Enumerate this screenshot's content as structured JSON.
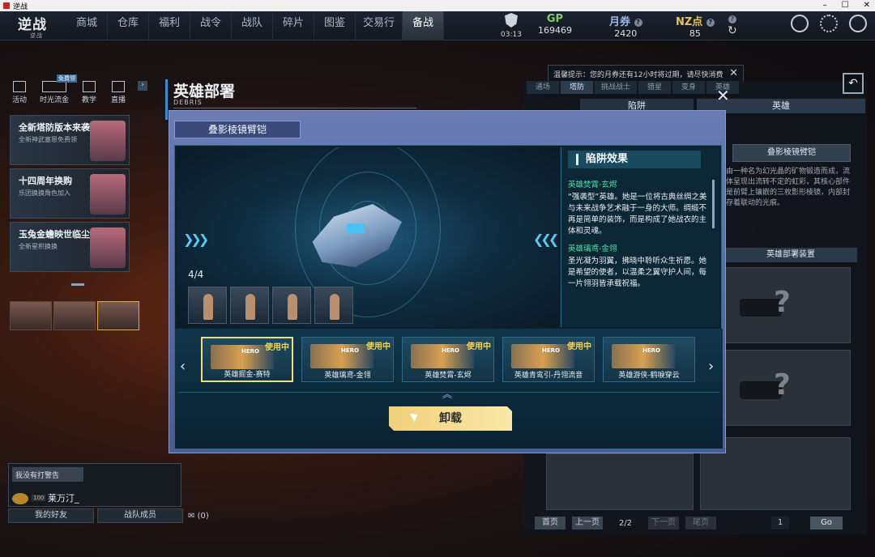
{
  "window": {
    "title": "逆战"
  },
  "nav": {
    "logo": "逆战",
    "logo_sub": "逆战",
    "tabs": [
      "商城",
      "仓库",
      "福利",
      "战令",
      "战队",
      "碎片",
      "图鉴",
      "交易行",
      "备战"
    ],
    "active_tab": 8
  },
  "status": {
    "clock": "03:13",
    "gp_label": "GP",
    "gp_value": "169469",
    "yq_label": "月券",
    "yq_value": "2420",
    "nz_label": "NZ点",
    "nz_value": "85",
    "q_mark": "?"
  },
  "notice": {
    "text": "温馨提示：您的月券还有12小时将过期，请尽快消费"
  },
  "left": {
    "tools": [
      "活动",
      "时光流金",
      "教学",
      "直播"
    ],
    "tool_badge": "免费领",
    "promos": [
      {
        "title": "全新塔防版本来袭",
        "sub": "全新神武塞恩免费领"
      },
      {
        "title": "十四周年换购",
        "sub": "乐团换换角色加入"
      },
      {
        "title": "玉兔金蟾映世临尘",
        "sub": "全新星积换换"
      }
    ],
    "profile_tag": "我没有打警告",
    "profile_level": "100",
    "profile_name": "莱万汀_",
    "friends_btn": "我的好友",
    "members_btn": "战队成员",
    "mail_count": "(0)"
  },
  "right": {
    "tabs": [
      "通场",
      "塔防",
      "挑战战士",
      "猎星",
      "变身",
      "英雄"
    ],
    "active_tab": 1,
    "trap_tab": "陷阱",
    "col_header": "英雄",
    "desc": "由一种名为幻光晶的矿物锻造而成，流体呈现出流转不定的虹彩，其核心部件是前臂上镶嵌的三枚影形棱镜，内部封存着联动的光痕。",
    "armor_name": "叠影棱镜臂铠",
    "deploy_header": "英雄部署装置",
    "pager": {
      "first": "首页",
      "prev": "上一页",
      "page": "2/2",
      "next": "下一页",
      "last": "尾页",
      "input": "1",
      "go": "Go"
    }
  },
  "heading": {
    "title": "英雄部署",
    "subtitle": "DEBRIS"
  },
  "modal": {
    "title": "叠影棱镜臂铠",
    "count": "4/4",
    "effect_header": "陷阱效果",
    "effects": [
      {
        "name": "英雄焚霄-玄烬",
        "text": "“强袭型”英雄。她是一位将古典丝绸之美与未来战争艺术融于一身的大师。绸缎不再是简单的装饰，而是构成了她战衣的主体和灵魂。"
      },
      {
        "name": "英雄璃鸢-金翎",
        "text": "圣光凝为羽翼，拂晓中聆听众生祈愿。她是希望的使者，以温柔之翼守护人间，每一片翎羽皆承载祝福。"
      }
    ],
    "cards": [
      {
        "name": "英雄掘金-赛特",
        "in_use": "使用中",
        "badge": "HERO",
        "selected": true
      },
      {
        "name": "英雄璃鸢-金翎",
        "in_use": "使用中",
        "badge": "HERO",
        "selected": false
      },
      {
        "name": "英雄焚霄-玄烬",
        "in_use": "使用中",
        "badge": "HERO",
        "selected": false
      },
      {
        "name": "英雄青鸾引-丹翎流音",
        "in_use": "使用中",
        "badge": "HERO",
        "selected": false
      },
      {
        "name": "英雄游侠-鹤唳穿云",
        "in_use": "",
        "badge": "HERO",
        "selected": false
      }
    ],
    "unload_label": "卸载",
    "close": "✕"
  }
}
